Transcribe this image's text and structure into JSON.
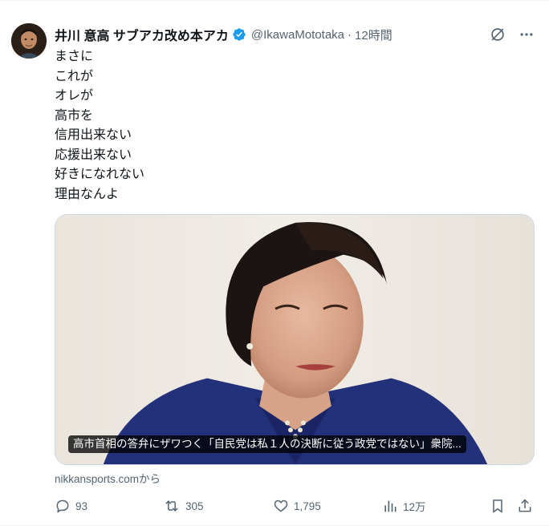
{
  "author": {
    "display_name": "井川 意高 サブアカ改め本アカ",
    "handle": "@IkawaMototaka",
    "separator": "·",
    "time": "12時間"
  },
  "text_lines": [
    "まさに",
    "これが",
    "オレが",
    "高市を",
    "信用出来ない",
    "応援出来ない",
    "好きになれない",
    "理由なんよ"
  ],
  "card": {
    "title": "高市首相の答弁にザワつく「自民党は私１人の決断に従う政党ではない」衆院...",
    "source": "nikkansports.comから"
  },
  "stats": {
    "replies": "93",
    "reposts": "305",
    "likes": "1,795",
    "views": "12万"
  },
  "icons": {
    "verified": "verified-badge-icon",
    "grok": "grok-icon",
    "more": "more-icon",
    "reply": "reply-icon",
    "repost": "repost-icon",
    "like": "like-icon",
    "views": "views-icon",
    "bookmark": "bookmark-icon",
    "share": "share-icon"
  },
  "colors": {
    "verified": "#1d9bf0",
    "muted": "#536471",
    "text": "#0f1419"
  }
}
